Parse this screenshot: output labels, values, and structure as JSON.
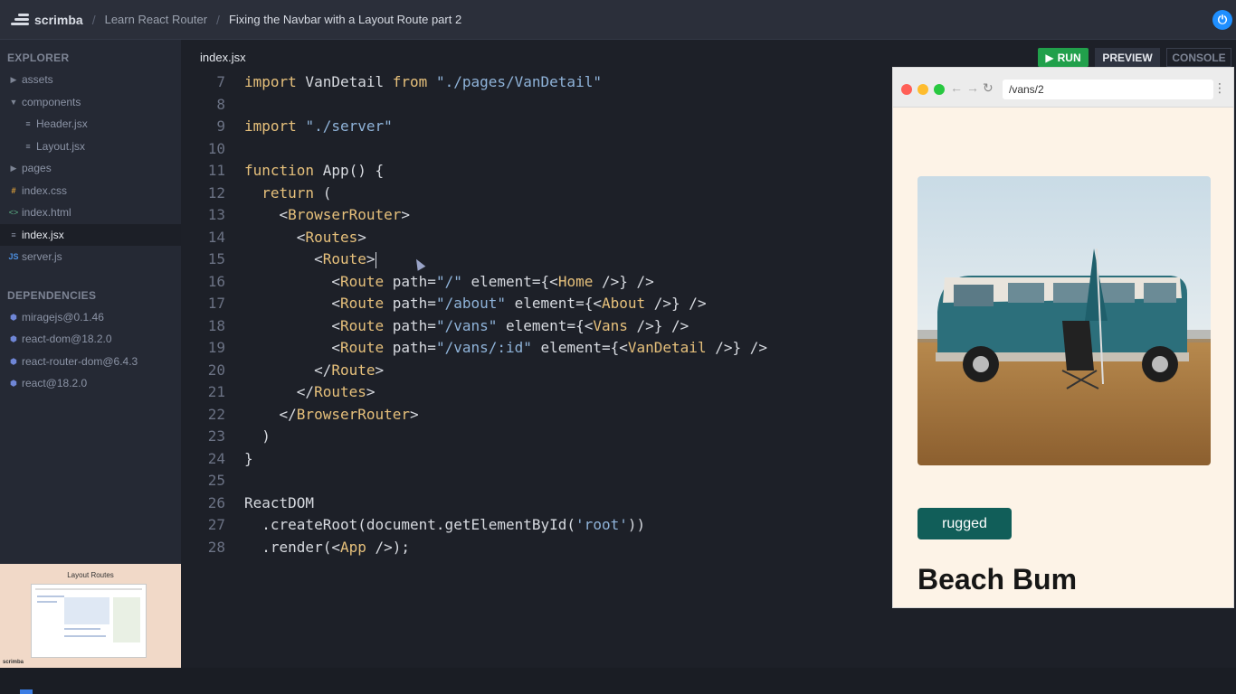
{
  "topbar": {
    "brand": "scrimba",
    "breadcrumb": [
      "Learn React Router",
      "Fixing the Navbar with a Layout Route part 2"
    ],
    "power_label": "⏻"
  },
  "sidebar": {
    "explorer_title": "EXPLORER",
    "files": [
      {
        "label": "assets",
        "type": "folder",
        "icon": "▶",
        "indent": 0
      },
      {
        "label": "components",
        "type": "folder-open",
        "icon": "▼",
        "indent": 0
      },
      {
        "label": "Header.jsx",
        "type": "file",
        "icon": "≡",
        "indent": 1
      },
      {
        "label": "Layout.jsx",
        "type": "file",
        "icon": "≡",
        "indent": 1
      },
      {
        "label": "pages",
        "type": "folder",
        "icon": "▶",
        "indent": 0
      },
      {
        "label": "index.css",
        "type": "css",
        "icon": "#",
        "indent": 0
      },
      {
        "label": "index.html",
        "type": "html",
        "icon": "<>",
        "indent": 0
      },
      {
        "label": "index.jsx",
        "type": "file-selected",
        "icon": "≡",
        "indent": 0
      },
      {
        "label": "server.js",
        "type": "js",
        "icon": "JS",
        "indent": 0
      }
    ],
    "deps_title": "DEPENDENCIES",
    "deps": [
      "miragejs@0.1.46",
      "react-dom@18.2.0",
      "react-router-dom@6.4.3",
      "react@18.2.0"
    ],
    "thumbnail_title": "Layout Routes",
    "thumbnail_brand": "scrimba"
  },
  "editor": {
    "tab": "index.jsx",
    "lines": [
      {
        "n": "7",
        "segs": [
          [
            "kw",
            "import"
          ],
          [
            "tx",
            " VanDetail "
          ],
          [
            "kw",
            "from"
          ],
          [
            "tx",
            " "
          ],
          [
            "str",
            "\"./pages/VanDetail\""
          ]
        ]
      },
      {
        "n": "8",
        "segs": []
      },
      {
        "n": "9",
        "segs": [
          [
            "kw",
            "import"
          ],
          [
            "tx",
            " "
          ],
          [
            "str",
            "\"./server\""
          ]
        ]
      },
      {
        "n": "10",
        "segs": []
      },
      {
        "n": "11",
        "segs": [
          [
            "kw",
            "function"
          ],
          [
            "tx",
            " App() {"
          ]
        ]
      },
      {
        "n": "12",
        "segs": [
          [
            "tx",
            "  "
          ],
          [
            "kw",
            "return"
          ],
          [
            "tx",
            " ("
          ]
        ]
      },
      {
        "n": "13",
        "segs": [
          [
            "tx",
            "    <"
          ],
          [
            "tname",
            "BrowserRouter"
          ],
          [
            "tx",
            ">"
          ]
        ]
      },
      {
        "n": "14",
        "segs": [
          [
            "tx",
            "      <"
          ],
          [
            "tname",
            "Routes"
          ],
          [
            "tx",
            ">"
          ]
        ]
      },
      {
        "n": "15",
        "segs": [
          [
            "tx",
            "        <"
          ],
          [
            "tname",
            "Route"
          ],
          [
            "tx",
            ">"
          ]
        ],
        "caret": true
      },
      {
        "n": "16",
        "segs": [
          [
            "tx",
            "          <"
          ],
          [
            "tname",
            "Route"
          ],
          [
            "tx",
            " path="
          ],
          [
            "str",
            "\"/\""
          ],
          [
            "tx",
            " element={<"
          ],
          [
            "tname",
            "Home"
          ],
          [
            "tx",
            " />} />"
          ]
        ]
      },
      {
        "n": "17",
        "segs": [
          [
            "tx",
            "          <"
          ],
          [
            "tname",
            "Route"
          ],
          [
            "tx",
            " path="
          ],
          [
            "str",
            "\"/about\""
          ],
          [
            "tx",
            " element={<"
          ],
          [
            "tname",
            "About"
          ],
          [
            "tx",
            " />} />"
          ]
        ]
      },
      {
        "n": "18",
        "segs": [
          [
            "tx",
            "          <"
          ],
          [
            "tname",
            "Route"
          ],
          [
            "tx",
            " path="
          ],
          [
            "str",
            "\"/vans\""
          ],
          [
            "tx",
            " element={<"
          ],
          [
            "tname",
            "Vans"
          ],
          [
            "tx",
            " />} />"
          ]
        ]
      },
      {
        "n": "19",
        "segs": [
          [
            "tx",
            "          <"
          ],
          [
            "tname",
            "Route"
          ],
          [
            "tx",
            " path="
          ],
          [
            "str",
            "\"/vans/:id\""
          ],
          [
            "tx",
            " element={<"
          ],
          [
            "tname",
            "VanDetail"
          ],
          [
            "tx",
            " />} />"
          ]
        ]
      },
      {
        "n": "20",
        "segs": [
          [
            "tx",
            "        </"
          ],
          [
            "tname",
            "Route"
          ],
          [
            "tx",
            ">"
          ]
        ]
      },
      {
        "n": "21",
        "segs": [
          [
            "tx",
            "      </"
          ],
          [
            "tname",
            "Routes"
          ],
          [
            "tx",
            ">"
          ]
        ]
      },
      {
        "n": "22",
        "segs": [
          [
            "tx",
            "    </"
          ],
          [
            "tname",
            "BrowserRouter"
          ],
          [
            "tx",
            ">"
          ]
        ]
      },
      {
        "n": "23",
        "segs": [
          [
            "tx",
            "  )"
          ]
        ]
      },
      {
        "n": "24",
        "segs": [
          [
            "tx",
            "}"
          ]
        ]
      },
      {
        "n": "25",
        "segs": []
      },
      {
        "n": "26",
        "segs": [
          [
            "tx",
            "ReactDOM"
          ]
        ]
      },
      {
        "n": "27",
        "segs": [
          [
            "tx",
            "  .createRoot(document.getElementById("
          ],
          [
            "str",
            "'root'"
          ],
          [
            "tx",
            "))"
          ]
        ]
      },
      {
        "n": "28",
        "segs": [
          [
            "tx",
            "  .render(<"
          ],
          [
            "tname",
            "App"
          ],
          [
            "tx",
            " />);"
          ]
        ]
      }
    ]
  },
  "toolbar": {
    "run_label": "RUN",
    "preview_label": "PREVIEW",
    "console_label": "CONSOLE"
  },
  "preview": {
    "url": "/vans/2",
    "badge": "rugged",
    "title": "Beach Bum"
  },
  "colors": {
    "run_green": "#21a04b",
    "badge_teal": "#115e59",
    "preview_bg": "#fdf3e7",
    "accent_blue": "#1f8fff"
  }
}
